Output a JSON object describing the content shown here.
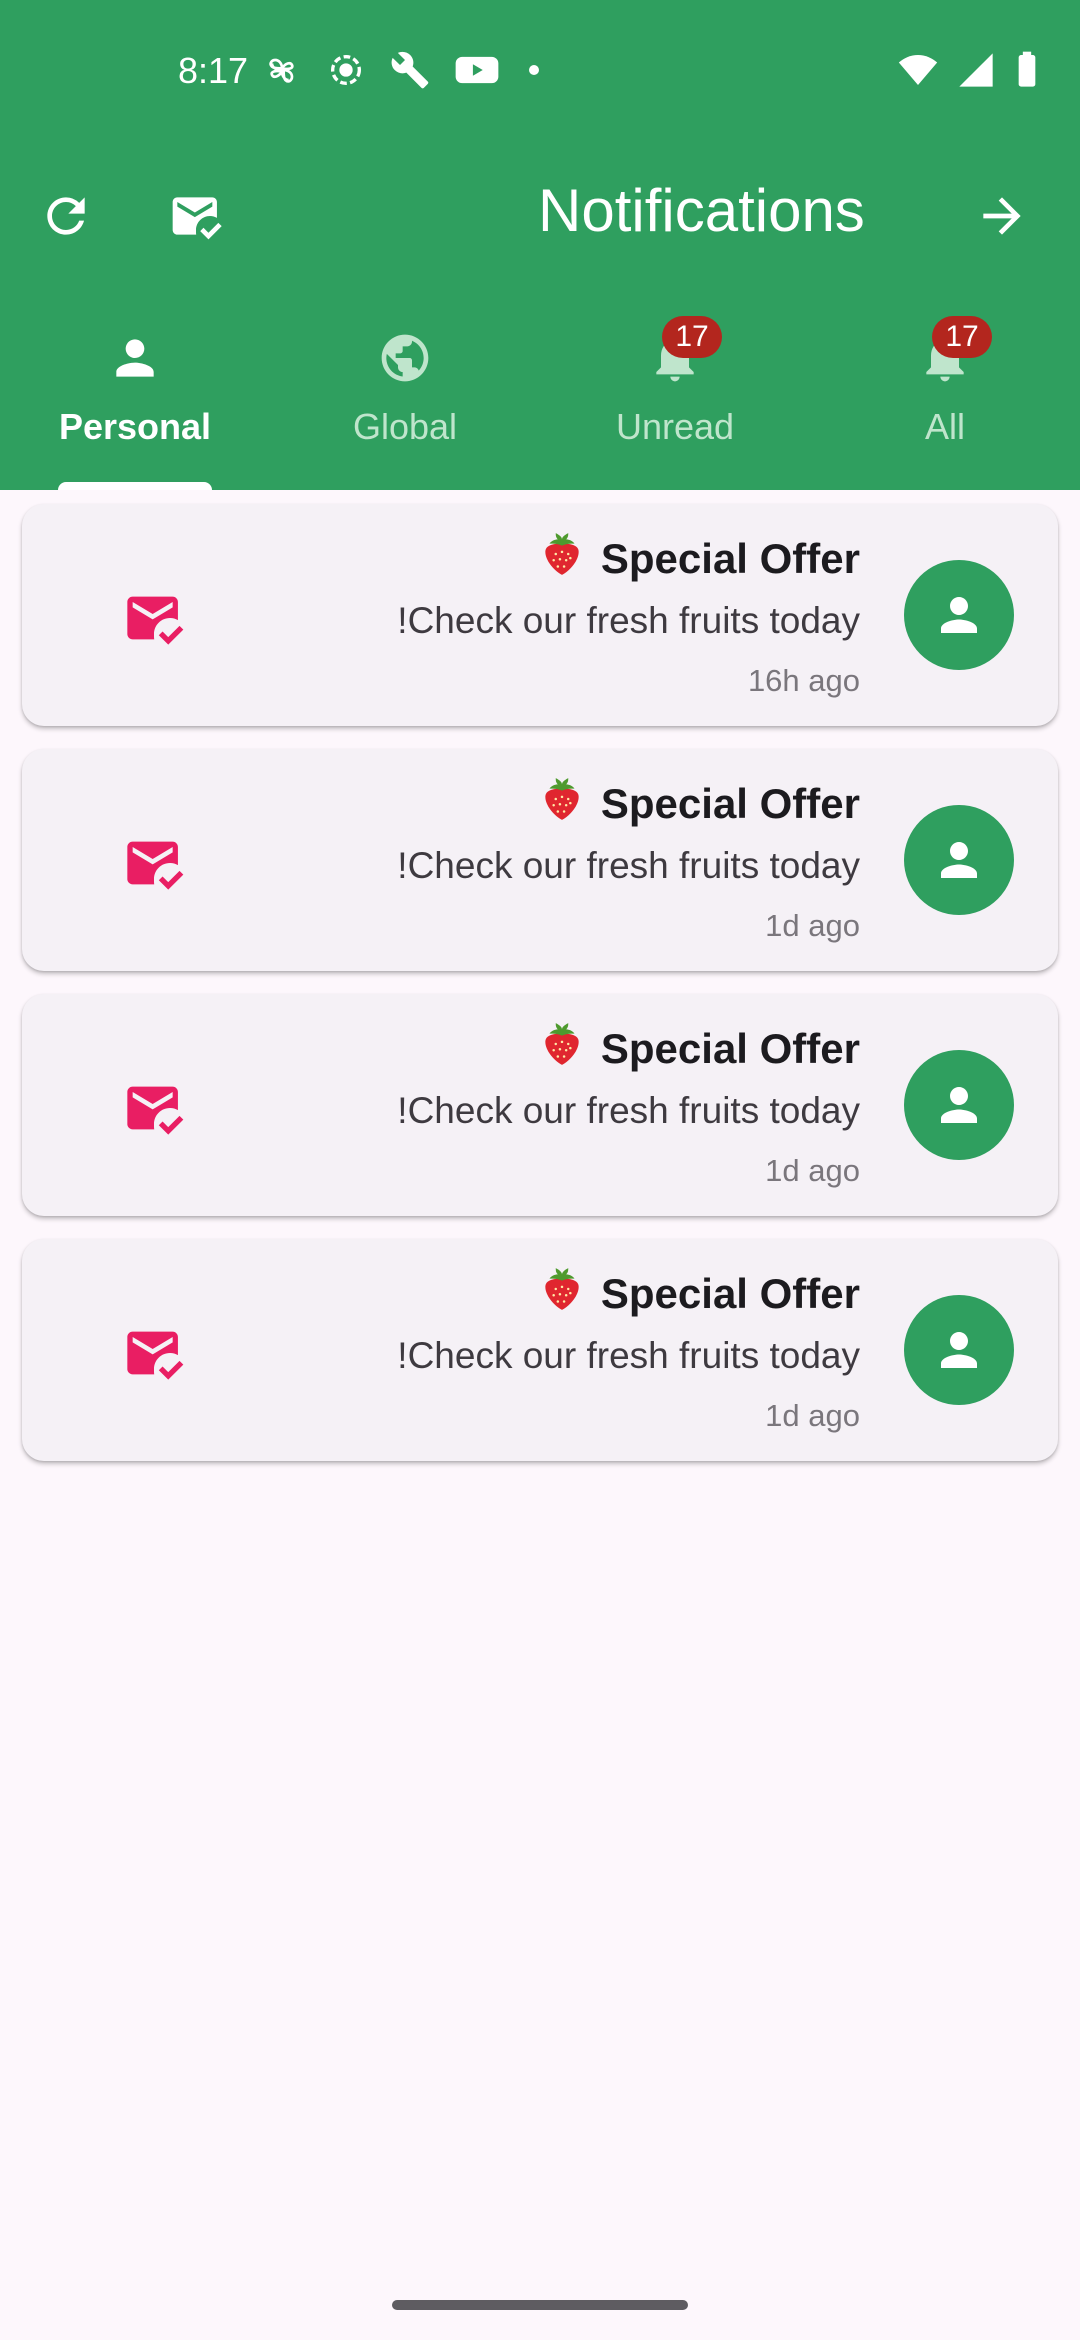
{
  "status_bar": {
    "time": "8:17",
    "left_icons": [
      "pinwheel-icon",
      "record-icon",
      "wrench-icon",
      "youtube-icon",
      "dot-icon"
    ],
    "right_icons": [
      "wifi-icon",
      "signal-icon",
      "battery-icon"
    ]
  },
  "app_bar": {
    "title": "Notifications",
    "actions": [
      "refresh-icon",
      "mark-all-read-icon",
      "arrow-forward-icon"
    ]
  },
  "colors": {
    "primary": "#2F9F5F",
    "accent_pink": "#E91E63",
    "badge": "#B3261E",
    "background": "#FDF7FC",
    "card": "#F5F1F6"
  },
  "tabs": [
    {
      "label": "Personal",
      "icon": "person-icon",
      "active": true,
      "badge": ""
    },
    {
      "label": "Global",
      "icon": "globe-icon",
      "active": false,
      "badge": ""
    },
    {
      "label": "Unread",
      "icon": "bell-icon",
      "active": false,
      "badge": "17"
    },
    {
      "label": "All",
      "icon": "bell-icon",
      "active": false,
      "badge": "17"
    }
  ],
  "notifications": [
    {
      "title": "Special Offer",
      "emoji": "strawberry",
      "body": "!Check our fresh fruits today",
      "time": "16h ago"
    },
    {
      "title": "Special Offer",
      "emoji": "strawberry",
      "body": "!Check our fresh fruits today",
      "time": "1d ago"
    },
    {
      "title": "Special Offer",
      "emoji": "strawberry",
      "body": "!Check our fresh fruits today",
      "time": "1d ago"
    },
    {
      "title": "Special Offer",
      "emoji": "strawberry",
      "body": "!Check our fresh fruits today",
      "time": "1d ago"
    }
  ]
}
